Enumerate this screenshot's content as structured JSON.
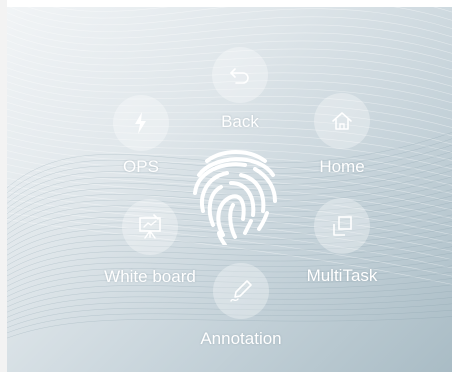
{
  "menu": {
    "back_label": "Back",
    "ops_label": "OPS",
    "home_label": "Home",
    "whiteboard_label": "White board",
    "multitask_label": "MultiTask",
    "annotation_label": "Annotation"
  },
  "icons": {
    "back": "back-arrow-icon",
    "ops": "lightning-icon",
    "home": "home-icon",
    "whiteboard": "whiteboard-icon",
    "multitask": "multitask-icon",
    "annotation": "pen-icon",
    "center": "fingerprint-icon"
  },
  "colors": {
    "background_light": "#f1f4f6",
    "background_dark": "#a9bcc5",
    "label": "#ffffff",
    "circle": "rgba(255,255,255,0.32)"
  }
}
